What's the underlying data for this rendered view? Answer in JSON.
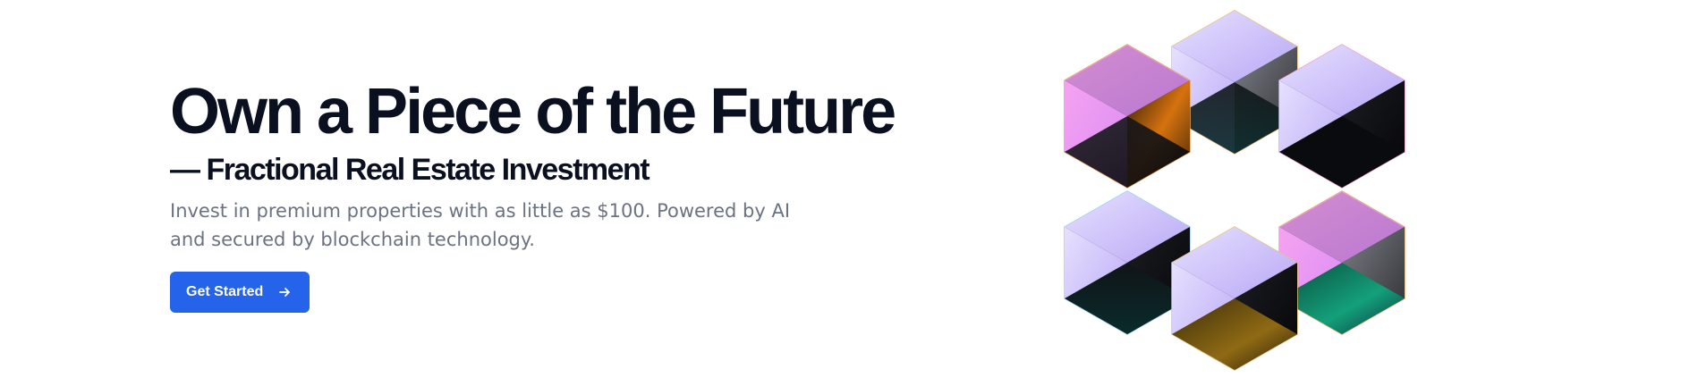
{
  "hero": {
    "title": "Own a Piece of the Future",
    "subtitle": "— Fractional Real Estate Investment",
    "description": "Invest in premium properties with as little as $100. Powered by AI and secured by blockchain technology.",
    "cta_label": "Get Started",
    "cta_icon": "arrow-right-icon",
    "illustration": "abstract-3d-cubes-illustration"
  },
  "colors": {
    "title": "#0b1020",
    "text_muted": "#6b7280",
    "accent": "#2563eb"
  }
}
